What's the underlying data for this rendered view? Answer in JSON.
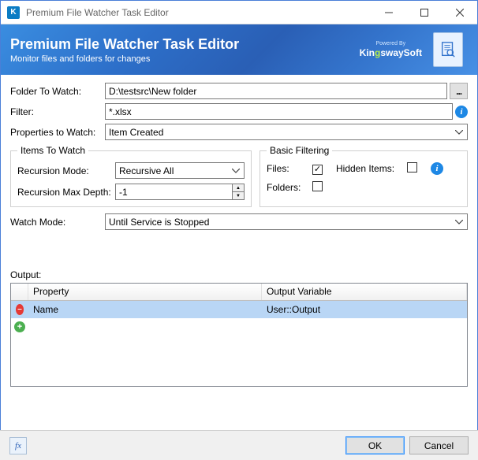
{
  "window": {
    "title": "Premium File Watcher Task Editor"
  },
  "banner": {
    "title": "Premium File Watcher Task Editor",
    "subtitle": "Monitor files and folders for changes",
    "powered_by": "Powered By",
    "brand_part1": "Kin",
    "brand_part2": "g",
    "brand_part3": "swaySoft"
  },
  "labels": {
    "folder_to_watch": "Folder To Watch:",
    "filter": "Filter:",
    "properties_to_watch": "Properties to Watch:",
    "items_to_watch": "Items To Watch",
    "recursion_mode": "Recursion Mode:",
    "recursion_max_depth": "Recursion Max Depth:",
    "basic_filtering": "Basic Filtering",
    "files": "Files:",
    "hidden_items": "Hidden Items:",
    "folders": "Folders:",
    "watch_mode": "Watch Mode:",
    "output": "Output:",
    "col_property": "Property",
    "col_output_variable": "Output Variable",
    "ok": "OK",
    "cancel": "Cancel",
    "browse": "..."
  },
  "values": {
    "folder_to_watch": "D:\\testsrc\\New folder",
    "filter": "*.xlsx",
    "properties_to_watch": "Item Created",
    "recursion_mode": "Recursive All",
    "recursion_max_depth": "-1",
    "watch_mode": "Until Service is Stopped",
    "files_checked": true,
    "hidden_items_checked": false,
    "folders_checked": false
  },
  "output_rows": [
    {
      "property": "Name",
      "variable": "User::Output"
    }
  ]
}
